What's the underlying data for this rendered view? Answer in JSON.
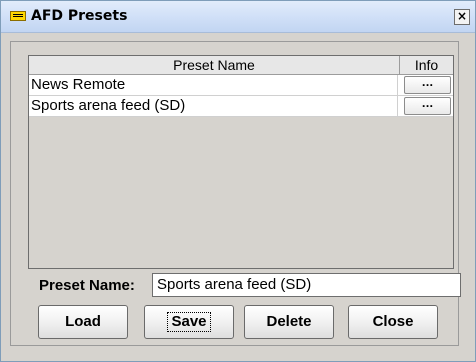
{
  "window": {
    "title": "AFD Presets",
    "close_glyph": "×"
  },
  "table": {
    "columns": [
      "Preset Name",
      "Info"
    ],
    "rows": [
      {
        "name": "News Remote",
        "info_label": "..."
      },
      {
        "name": "Sports arena feed (SD)",
        "info_label": "..."
      }
    ]
  },
  "preset_name": {
    "label": "Preset Name:",
    "value": "Sports arena feed (SD)"
  },
  "buttons": {
    "load": "Load",
    "save": "Save",
    "delete": "Delete",
    "close": "Close"
  },
  "icons": {
    "app": "afd-preset-icon",
    "close": "close-icon"
  },
  "colors": {
    "titlebar": "#cfdff7",
    "dialog_bg": "#d6d3ce",
    "table_row_bg": "#ffffff"
  }
}
